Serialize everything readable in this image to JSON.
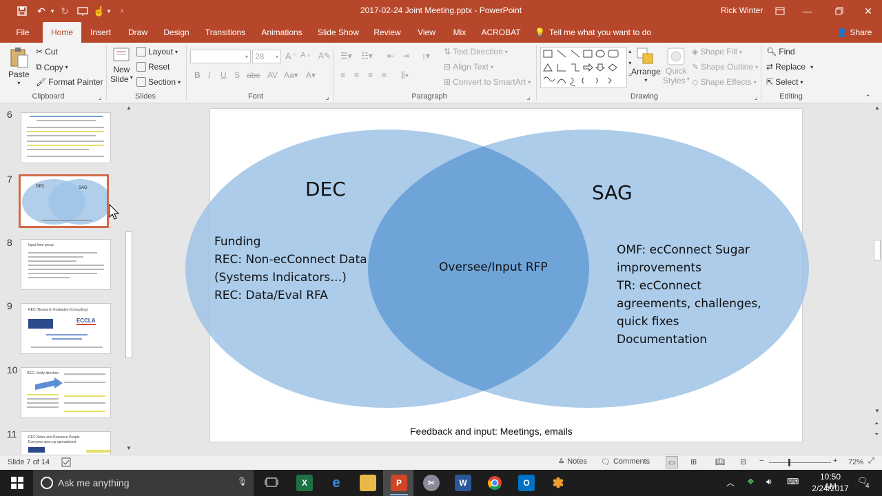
{
  "window": {
    "title": "2017-02-24 Joint Meeting.pptx - PowerPoint",
    "user": "Rick Winter"
  },
  "tabs": [
    "File",
    "Home",
    "Insert",
    "Draw",
    "Design",
    "Transitions",
    "Animations",
    "Slide Show",
    "Review",
    "View",
    "Mix",
    "ACROBAT"
  ],
  "tell_me": "Tell me what you want to do",
  "share": "Share",
  "ribbon": {
    "clipboard": {
      "paste": "Paste",
      "cut": "Cut",
      "copy": "Copy",
      "format_painter": "Format Painter",
      "label": "Clipboard"
    },
    "slides": {
      "new_slide": "New",
      "new_slide2": "Slide",
      "layout": "Layout",
      "reset": "Reset",
      "section": "Section",
      "label": "Slides"
    },
    "font": {
      "size": "28",
      "label": "Font"
    },
    "paragraph": {
      "text_direction": "Text Direction",
      "align_text": "Align Text",
      "smartart": "Convert to SmartArt",
      "label": "Paragraph"
    },
    "drawing": {
      "arrange": "Arrange",
      "quick_styles": "Quick",
      "quick_styles2": "Styles",
      "shape_fill": "Shape Fill",
      "shape_outline": "Shape Outline",
      "shape_effects": "Shape Effects",
      "label": "Drawing"
    },
    "editing": {
      "find": "Find",
      "replace": "Replace",
      "select": "Select",
      "label": "Editing"
    }
  },
  "slides_panel": {
    "numbers": [
      "6",
      "7",
      "8",
      "9",
      "10",
      "11"
    ],
    "thumb7": {
      "left": "DEC",
      "right": "SAG"
    },
    "thumb8_title": "Input from group",
    "thumb9": {
      "title": "REC (Research Evaluation Consulting)",
      "logo": "ECCLA"
    },
    "thumb10_title": "REC: Verify direction",
    "thumb11_title": "REC Notes and Resource People",
    "thumb11_sub": "Everyone open up spreadsheet"
  },
  "slide": {
    "left_title": "DEC",
    "right_title": "SAG",
    "left_lines": [
      "Funding",
      "REC: Non-ecConnect Data",
      "(Systems Indicators…)",
      "REC: Data/Eval RFA"
    ],
    "center_text": "Oversee/Input RFP",
    "right_lines": [
      "OMF: ecConnect Sugar",
      "improvements",
      "TR: ecConnect",
      "agreements, challenges,",
      "quick fixes",
      "Documentation"
    ],
    "footer": "Feedback and input: Meetings, emails",
    "colors": {
      "ellipse": "#9dc3e6",
      "overlap": "#6fa4d8"
    }
  },
  "status": {
    "slide_info": "Slide 7 of 14",
    "notes": "Notes",
    "comments": "Comments",
    "zoom": "72%"
  },
  "taskbar": {
    "search": "Ask me anything",
    "time": "10:50 AM",
    "date": "2/24/2017",
    "notifications": "4"
  }
}
